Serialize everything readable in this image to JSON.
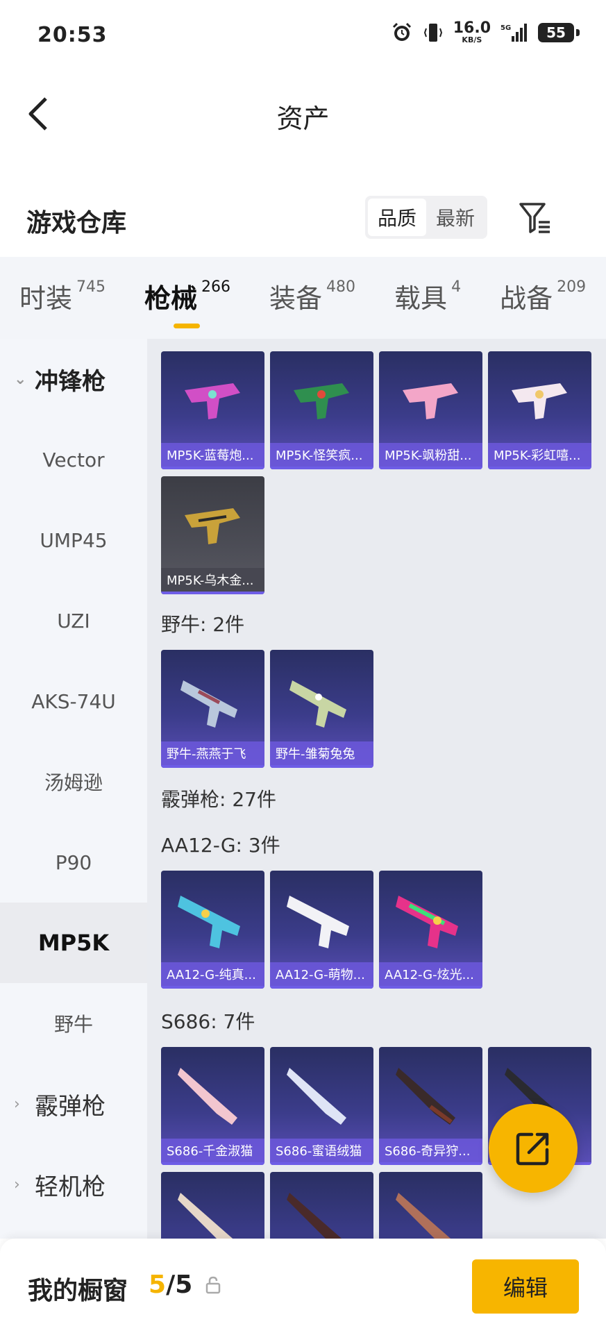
{
  "status_bar": {
    "time": "20:53",
    "net_speed_value": "16.0",
    "net_speed_unit": "KB/S",
    "battery": "55"
  },
  "header": {
    "title": "资产"
  },
  "section": {
    "title": "游戏仓库",
    "sort_options": [
      "品质",
      "最新"
    ]
  },
  "tabs": [
    {
      "label": "时装",
      "count": "745"
    },
    {
      "label": "枪械",
      "count": "266"
    },
    {
      "label": "装备",
      "count": "480"
    },
    {
      "label": "载具",
      "count": "4"
    },
    {
      "label": "战备",
      "count": "209"
    }
  ],
  "sidebar": {
    "group_smg": "冲锋枪",
    "items": [
      "Vector",
      "UMP45",
      "UZI",
      "AKS-74U",
      "汤姆逊",
      "P90",
      "MP5K",
      "野牛"
    ],
    "group_shotgun": "霰弹枪",
    "group_lmg": "轻机枪"
  },
  "content": {
    "mp5k_items": [
      "MP5K-蓝莓炮...",
      "MP5K-怪笑疯...",
      "MP5K-飒粉甜...",
      "MP5K-彩虹嘻...",
      "MP5K-乌木金..."
    ],
    "bizon_label": "野牛: 2件",
    "bizon_items": [
      "野牛-燕燕于飞",
      "野牛-雏菊兔兔"
    ],
    "shotgun_label": "霰弹枪: 27件",
    "aa12_label": "AA12-G: 3件",
    "aa12_items": [
      "AA12-G-纯真...",
      "AA12-G-萌物...",
      "AA12-G-炫光..."
    ],
    "s686_label": "S686: 7件",
    "s686_items": [
      "S686-千金淑猫",
      "S686-蜜语绒猫",
      "S686-奇异狩..."
    ]
  },
  "bottom": {
    "showcase_label": "我的橱窗",
    "showcase_current": "5",
    "showcase_total": "/5",
    "edit_label": "编辑"
  },
  "colors": {
    "accent": "#f7b500",
    "card_top": "#2a2f63",
    "card_label": "#6c58dc"
  }
}
